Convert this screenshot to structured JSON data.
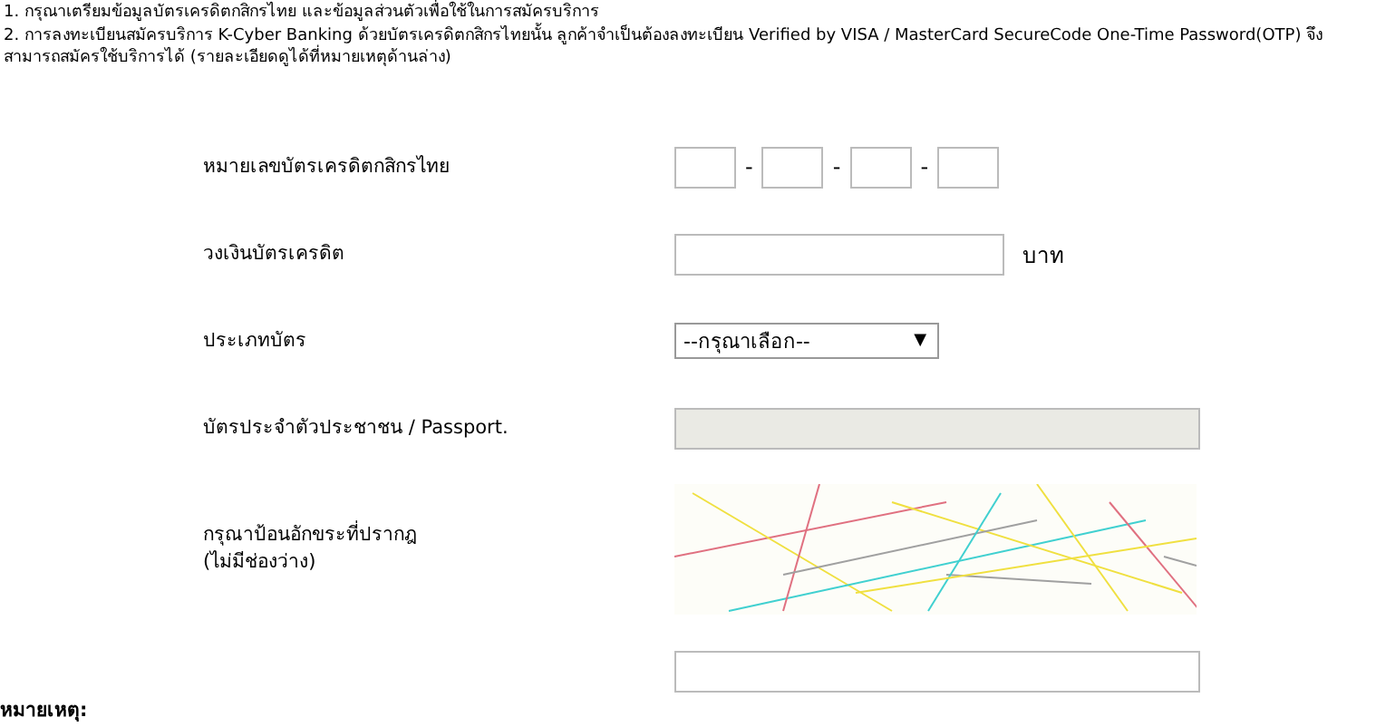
{
  "notes": [
    "1. กรุณาเตรียมข้อมูลบัตรเครดิตกสิกรไทย และข้อมูลส่วนตัวเพื่อใช้ในการสมัครบริการ",
    "2. การลงทะเบียนสมัครบริการ K-Cyber Banking ด้วยบัตรเครดิตกสิกรไทยนั้น ลูกค้าจำเป็นต้องลงทะเบียน Verified by VISA / MasterCard SecureCode One-Time Password(OTP) จึงสามารถสมัครใช้บริการได้ (รายละเอียดดูได้ที่หมายเหตุด้านล่าง)"
  ],
  "form": [
    {
      "kind": "card-number",
      "label": "หมายเลขบัตรเครดิตกสิกรไทย",
      "separator": "-"
    },
    {
      "kind": "text",
      "label": "วงเงินบัตรเครดิต",
      "unit": "บาท"
    },
    {
      "kind": "select",
      "label": "ประเภทบัตร",
      "value": "--กรุณาเลือก--",
      "arrow": "▼"
    },
    {
      "kind": "disabled-text",
      "label": "บัตรประจำตัวประชาชน / Passport."
    },
    {
      "kind": "captcha",
      "label": "กรุณาป้อนอักขระที่ปรากฎ",
      "sublabel": "(ไม่มีช่องว่าง)"
    },
    {
      "kind": "text"
    }
  ],
  "footer": "หมายเหตุ:"
}
